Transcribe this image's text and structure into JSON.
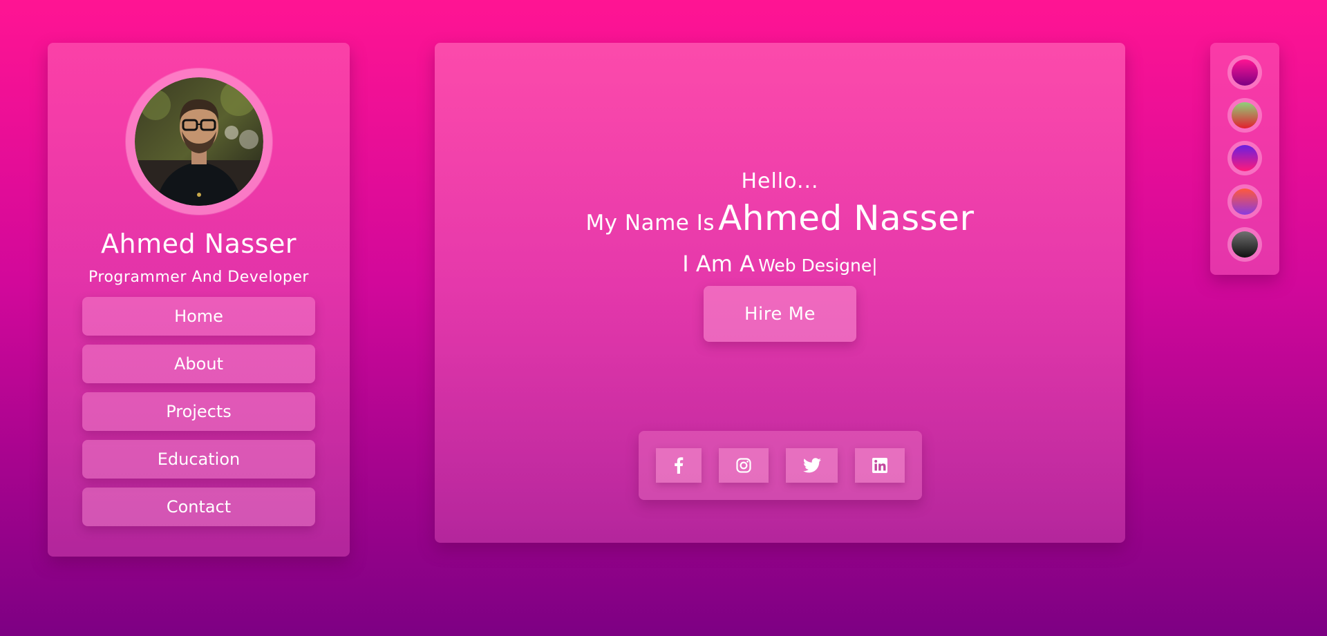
{
  "profile": {
    "name": "Ahmed Nasser",
    "role": "Programmer And Developer"
  },
  "nav": {
    "items": [
      {
        "label": "Home"
      },
      {
        "label": "About"
      },
      {
        "label": "Projects"
      },
      {
        "label": "Education"
      },
      {
        "label": "Contact"
      }
    ]
  },
  "hero": {
    "greeting": "Hello...",
    "name_prefix": "My Name Is",
    "name": "Ahmed Nasser",
    "role_prefix": "I Am A",
    "role_typed": "Web Designe",
    "cursor": "|",
    "hire_label": "Hire Me"
  },
  "social": {
    "icons": [
      "facebook-icon",
      "instagram-icon",
      "twitter-icon",
      "linkedin-icon"
    ]
  },
  "themes": {
    "swatches": [
      {
        "from": "#ff1493",
        "to": "#7d0083"
      },
      {
        "from": "#8fd17a",
        "to": "#e2202e"
      },
      {
        "from": "#6a1fe0",
        "to": "#ff1a7a"
      },
      {
        "from": "#ff5a3c",
        "to": "#8a3bde"
      },
      {
        "from": "#707070",
        "to": "#111111"
      }
    ]
  },
  "colors": {
    "accent": "#ff1493",
    "background_bottom": "#7d0083"
  }
}
